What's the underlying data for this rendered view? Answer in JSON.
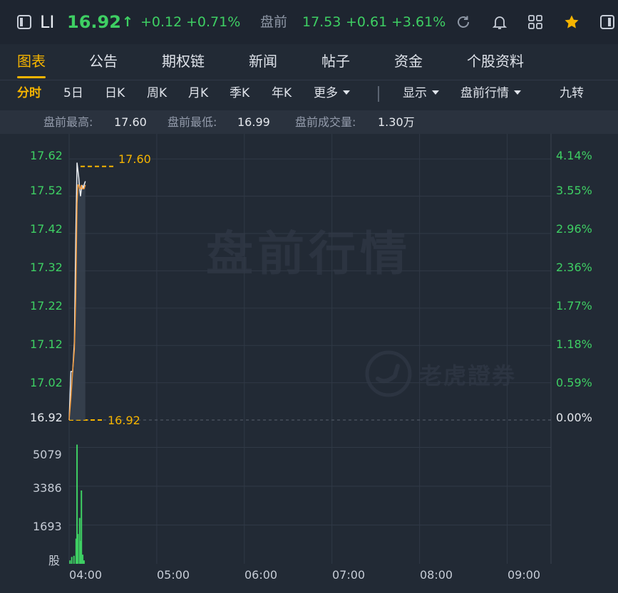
{
  "header": {
    "ticker": "LI",
    "price": "16.92",
    "arrow": "↑",
    "change": "+0.12",
    "change_pct": "+0.71%",
    "pre_label": "盘前",
    "pre_price": "17.53",
    "pre_change": "+0.61",
    "pre_change_pct": "+3.61%",
    "icons": [
      "sidebar-toggle-icon",
      "refresh-icon",
      "bell-icon",
      "grid-icon",
      "star-icon",
      "panel-icon"
    ]
  },
  "tabs": [
    "图表",
    "公告",
    "期权链",
    "新闻",
    "帖子",
    "资金",
    "个股资料"
  ],
  "periods": {
    "items": [
      "分时",
      "5日",
      "日K",
      "周K",
      "月K",
      "季K",
      "年K"
    ],
    "more": "更多",
    "display": "显示",
    "premarket": "盘前行情",
    "nine": "九转"
  },
  "stats": {
    "high_label": "盘前最高:",
    "high": "17.60",
    "low_label": "盘前最低:",
    "low": "16.99",
    "vol_label": "盘前成交量:",
    "vol": "1.30万"
  },
  "watermark": {
    "main": "盘前行情",
    "brand": "老虎證券"
  },
  "colors": {
    "up": "#3ecf63",
    "accent": "#f5b400",
    "background": "#222a35"
  },
  "chart_data": {
    "type": "line",
    "price_axis": {
      "ticks": [
        "17.62",
        "17.52",
        "17.42",
        "17.32",
        "17.22",
        "17.12",
        "17.02"
      ],
      "base": "16.92",
      "ylim": [
        16.92,
        17.63
      ]
    },
    "pct_axis": {
      "ticks": [
        "4.14%",
        "3.55%",
        "2.96%",
        "2.36%",
        "1.77%",
        "1.18%",
        "0.59%"
      ],
      "base": "0.00%"
    },
    "volume_axis": {
      "ticks": [
        "5079",
        "3386",
        "1693"
      ],
      "unit": "股",
      "ylim": [
        0,
        5900
      ]
    },
    "x_ticks": [
      "04:00",
      "05:00",
      "06:00",
      "07:00",
      "08:00",
      "09:00"
    ],
    "annotations": {
      "high": "17.60",
      "base": "16.92"
    },
    "series": [
      {
        "x": [
          4.0,
          4.02,
          4.04,
          4.06,
          4.075,
          4.09,
          4.1,
          4.11,
          4.12,
          4.13,
          4.14,
          4.15,
          4.16,
          4.17,
          4.185
        ],
        "price": [
          16.92,
          17.05,
          17.05,
          17.13,
          17.4,
          17.61,
          17.59,
          17.57,
          17.54,
          17.52,
          17.54,
          17.55,
          17.54,
          17.55,
          17.56
        ],
        "avg": [
          16.92,
          16.98,
          17.05,
          17.11,
          17.25,
          17.5,
          17.55,
          17.55,
          17.54,
          17.54,
          17.55,
          17.54,
          17.54,
          17.54,
          17.55
        ]
      }
    ],
    "volume": {
      "x": [
        4.01,
        4.03,
        4.055,
        4.08,
        4.09,
        4.1,
        4.12,
        4.13,
        4.14,
        4.155,
        4.17
      ],
      "values": [
        150,
        300,
        350,
        1100,
        5200,
        1300,
        2000,
        1000,
        3200,
        400,
        150
      ]
    }
  }
}
